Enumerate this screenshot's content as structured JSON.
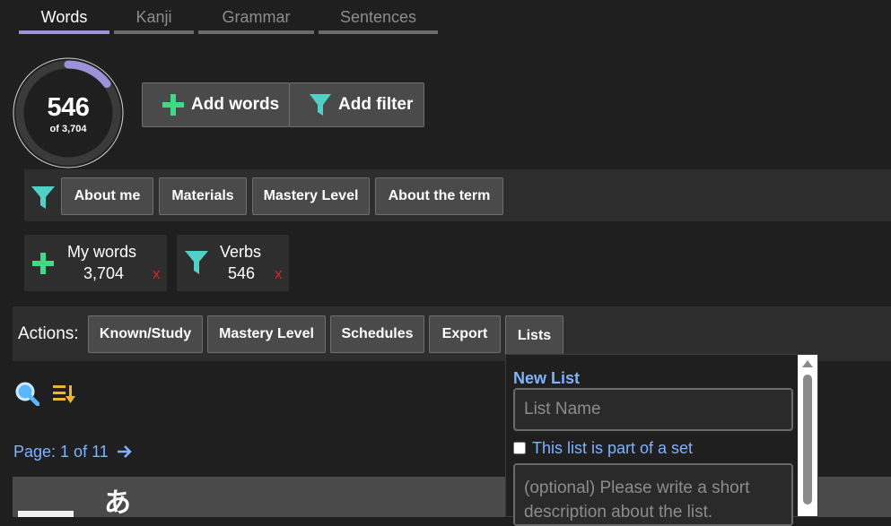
{
  "tabs": [
    {
      "label": "Words",
      "active": true
    },
    {
      "label": "Kanji",
      "active": false
    },
    {
      "label": "Grammar",
      "active": false
    },
    {
      "label": "Sentences",
      "active": false
    }
  ],
  "progress": {
    "count": "546",
    "total_label": "of 3,704",
    "fraction": 0.147
  },
  "top_buttons": {
    "add_words": "Add words",
    "add_filter": "Add filter"
  },
  "filter_buttons": [
    "About me",
    "Materials",
    "Mastery Level",
    "About the term"
  ],
  "chips": [
    {
      "name": "My words",
      "count": "3,704",
      "remove": "x"
    },
    {
      "name": "Verbs",
      "count": "546",
      "remove": "x"
    }
  ],
  "actions": {
    "label": "Actions:",
    "buttons": [
      "Known/Study",
      "Mastery Level",
      "Schedules",
      "Export",
      "Lists"
    ]
  },
  "pager": {
    "text": "Page: 1 of 11"
  },
  "list_item": {
    "kana": "あ"
  },
  "new_list_popup": {
    "title": "New List",
    "name_placeholder": "List Name",
    "set_label": "This list is part of a set",
    "description_placeholder": "(optional) Please write a short description about the list."
  },
  "colors": {
    "background": "#1f1f1f",
    "panel": "#2e2e2e",
    "button": "#4a4a4a",
    "accent_tab": "#9b93d8",
    "link_blue": "#7fb2ff",
    "plus_green": "#3ddc84",
    "filter_teal": "#4fd1c5",
    "sort_gold": "#f0b429",
    "remove_red": "#e02020"
  }
}
